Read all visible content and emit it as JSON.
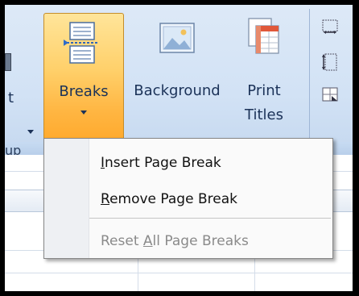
{
  "ribbon": {
    "partial_button_label": "t",
    "group_label": "up",
    "breaks": {
      "label": "Breaks"
    },
    "background": {
      "label": "Background"
    },
    "print_titles": {
      "line1": "Print",
      "line2": "Titles"
    }
  },
  "menu": {
    "items": [
      {
        "accel": "I",
        "rest": "nsert Page Break",
        "enabled": true
      },
      {
        "accel": "R",
        "rest": "emove Page Break",
        "enabled": true
      },
      {
        "pre": "Reset ",
        "accel": "A",
        "rest": "ll Page Breaks",
        "enabled": false
      }
    ]
  },
  "colors": {
    "highlight": "#ffb541",
    "ribbon": "#d2e2f5",
    "text": "#1b3258"
  }
}
